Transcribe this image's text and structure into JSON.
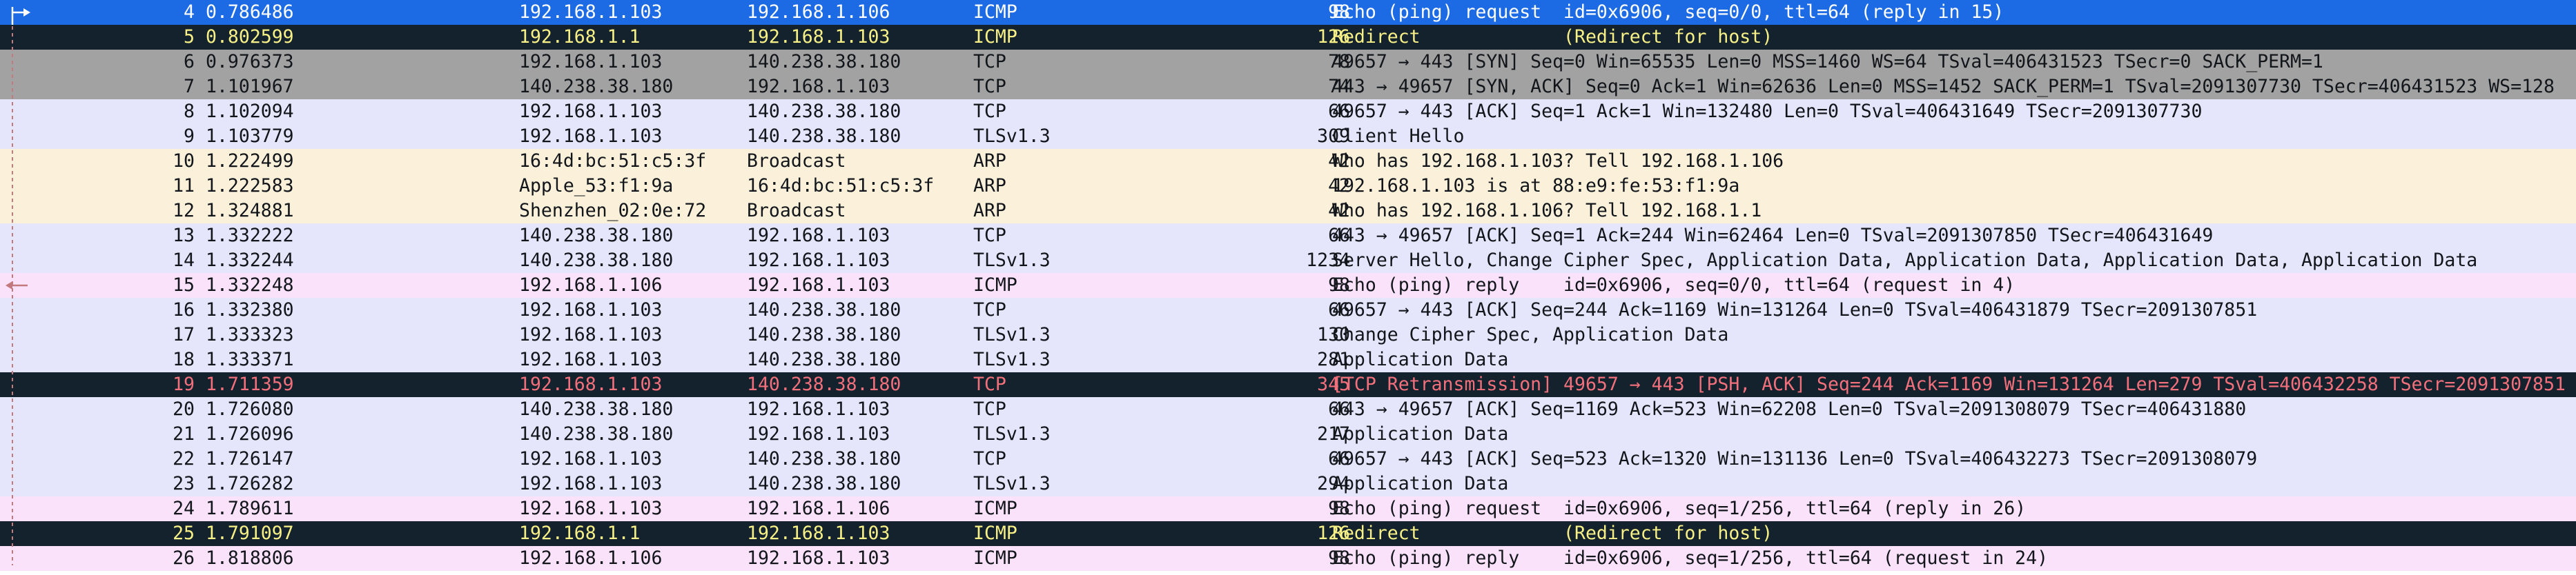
{
  "colors": {
    "selected_bg": "#1d6ae5",
    "selected_text": "#ffffff",
    "dark_bg": "#14222d",
    "dark_yellow_text": "#f6f087",
    "dark_red_text": "#f2707c",
    "gray_bg": "#a2a2a2",
    "tcp_bg": "#e5e6fb",
    "arp_bg": "#fbf1da",
    "icmp_bg": "#fbe2fb"
  },
  "packets": [
    {
      "no": "4",
      "time": "0.786486",
      "src": "192.168.1.103",
      "dst": "192.168.1.106",
      "proto": "ICMP",
      "len": "98",
      "info": "Echo (ping) request  id=0x6906, seq=0/0, ttl=64 (reply in 15)",
      "style": "selected"
    },
    {
      "no": "5",
      "time": "0.802599",
      "src": "192.168.1.1",
      "dst": "192.168.1.103",
      "proto": "ICMP",
      "len": "126",
      "info": "Redirect             (Redirect for host)",
      "style": "dark"
    },
    {
      "no": "6",
      "time": "0.976373",
      "src": "192.168.1.103",
      "dst": "140.238.38.180",
      "proto": "TCP",
      "len": "78",
      "info": "49657 → 443 [SYN] Seq=0 Win=65535 Len=0 MSS=1460 WS=64 TSval=406431523 TSecr=0 SACK_PERM=1",
      "style": "gray"
    },
    {
      "no": "7",
      "time": "1.101967",
      "src": "140.238.38.180",
      "dst": "192.168.1.103",
      "proto": "TCP",
      "len": "74",
      "info": "443 → 49657 [SYN, ACK] Seq=0 Ack=1 Win=62636 Len=0 MSS=1452 SACK_PERM=1 TSval=2091307730 TSecr=406431523 WS=128",
      "style": "gray"
    },
    {
      "no": "8",
      "time": "1.102094",
      "src": "192.168.1.103",
      "dst": "140.238.38.180",
      "proto": "TCP",
      "len": "66",
      "info": "49657 → 443 [ACK] Seq=1 Ack=1 Win=132480 Len=0 TSval=406431649 TSecr=2091307730",
      "style": "tcp"
    },
    {
      "no": "9",
      "time": "1.103779",
      "src": "192.168.1.103",
      "dst": "140.238.38.180",
      "proto": "TLSv1.3",
      "len": "309",
      "info": "Client Hello",
      "style": "tcp"
    },
    {
      "no": "10",
      "time": "1.222499",
      "src": "16:4d:bc:51:c5:3f",
      "dst": "Broadcast",
      "proto": "ARP",
      "len": "42",
      "info": "Who has 192.168.1.103? Tell 192.168.1.106",
      "style": "arp"
    },
    {
      "no": "11",
      "time": "1.222583",
      "src": "Apple_53:f1:9a",
      "dst": "16:4d:bc:51:c5:3f",
      "proto": "ARP",
      "len": "42",
      "info": "192.168.1.103 is at 88:e9:fe:53:f1:9a",
      "style": "arp"
    },
    {
      "no": "12",
      "time": "1.324881",
      "src": "Shenzhen_02:0e:72",
      "dst": "Broadcast",
      "proto": "ARP",
      "len": "42",
      "info": "Who has 192.168.1.106? Tell 192.168.1.1",
      "style": "arp"
    },
    {
      "no": "13",
      "time": "1.332222",
      "src": "140.238.38.180",
      "dst": "192.168.1.103",
      "proto": "TCP",
      "len": "66",
      "info": "443 → 49657 [ACK] Seq=1 Ack=244 Win=62464 Len=0 TSval=2091307850 TSecr=406431649",
      "style": "tcp"
    },
    {
      "no": "14",
      "time": "1.332244",
      "src": "140.238.38.180",
      "dst": "192.168.1.103",
      "proto": "TLSv1.3",
      "len": "1234",
      "info": "Server Hello, Change Cipher Spec, Application Data, Application Data, Application Data, Application Data",
      "style": "tcp"
    },
    {
      "no": "15",
      "time": "1.332248",
      "src": "192.168.1.106",
      "dst": "192.168.1.103",
      "proto": "ICMP",
      "len": "98",
      "info": "Echo (ping) reply    id=0x6906, seq=0/0, ttl=64 (request in 4)",
      "style": "icmp"
    },
    {
      "no": "16",
      "time": "1.332380",
      "src": "192.168.1.103",
      "dst": "140.238.38.180",
      "proto": "TCP",
      "len": "66",
      "info": "49657 → 443 [ACK] Seq=244 Ack=1169 Win=131264 Len=0 TSval=406431879 TSecr=2091307851",
      "style": "tcp"
    },
    {
      "no": "17",
      "time": "1.333323",
      "src": "192.168.1.103",
      "dst": "140.238.38.180",
      "proto": "TLSv1.3",
      "len": "130",
      "info": "Change Cipher Spec, Application Data",
      "style": "tcp"
    },
    {
      "no": "18",
      "time": "1.333371",
      "src": "192.168.1.103",
      "dst": "140.238.38.180",
      "proto": "TLSv1.3",
      "len": "281",
      "info": "Application Data",
      "style": "tcp"
    },
    {
      "no": "19",
      "time": "1.711359",
      "src": "192.168.1.103",
      "dst": "140.238.38.180",
      "proto": "TCP",
      "len": "345",
      "info": "[TCP Retransmission] 49657 → 443 [PSH, ACK] Seq=244 Ack=1169 Win=131264 Len=279 TSval=406432258 TSecr=2091307851",
      "style": "dark-red"
    },
    {
      "no": "20",
      "time": "1.726080",
      "src": "140.238.38.180",
      "dst": "192.168.1.103",
      "proto": "TCP",
      "len": "66",
      "info": "443 → 49657 [ACK] Seq=1169 Ack=523 Win=62208 Len=0 TSval=2091308079 TSecr=406431880",
      "style": "tcp"
    },
    {
      "no": "21",
      "time": "1.726096",
      "src": "140.238.38.180",
      "dst": "192.168.1.103",
      "proto": "TLSv1.3",
      "len": "217",
      "info": "Application Data",
      "style": "tcp"
    },
    {
      "no": "22",
      "time": "1.726147",
      "src": "192.168.1.103",
      "dst": "140.238.38.180",
      "proto": "TCP",
      "len": "66",
      "info": "49657 → 443 [ACK] Seq=523 Ack=1320 Win=131136 Len=0 TSval=406432273 TSecr=2091308079",
      "style": "tcp"
    },
    {
      "no": "23",
      "time": "1.726282",
      "src": "192.168.1.103",
      "dst": "140.238.38.180",
      "proto": "TLSv1.3",
      "len": "294",
      "info": "Application Data",
      "style": "tcp"
    },
    {
      "no": "24",
      "time": "1.789611",
      "src": "192.168.1.103",
      "dst": "192.168.1.106",
      "proto": "ICMP",
      "len": "98",
      "info": "Echo (ping) request  id=0x6906, seq=1/256, ttl=64 (reply in 26)",
      "style": "icmp"
    },
    {
      "no": "25",
      "time": "1.791097",
      "src": "192.168.1.1",
      "dst": "192.168.1.103",
      "proto": "ICMP",
      "len": "126",
      "info": "Redirect             (Redirect for host)",
      "style": "dark"
    },
    {
      "no": "26",
      "time": "1.818806",
      "src": "192.168.1.106",
      "dst": "192.168.1.103",
      "proto": "ICMP",
      "len": "98",
      "info": "Echo (ping) reply    id=0x6906, seq=1/256, ttl=64 (request in 24)",
      "style": "icmp"
    }
  ]
}
